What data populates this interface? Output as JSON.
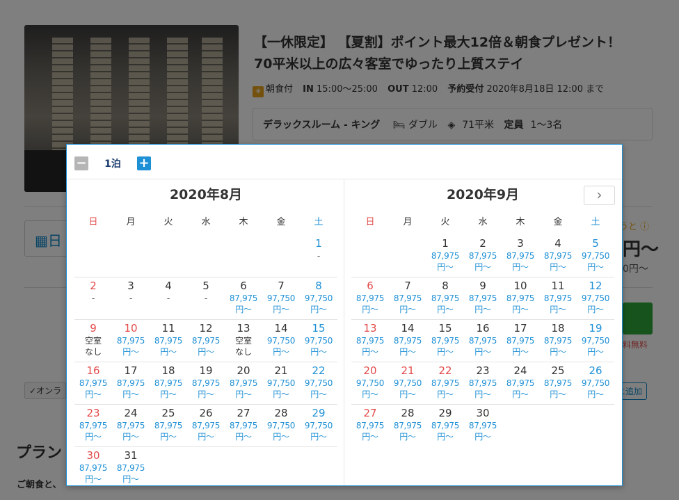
{
  "plan": {
    "title_line1": "【一休限定】 【夏割】ポイント最大12倍＆朝食プレゼント！",
    "title_line2": "70平米以上の広々客室でゆったり上質ステイ",
    "meal": "朝食付",
    "in_label": "IN",
    "in_time": "15:00〜25:00",
    "out_label": "OUT",
    "out_time": "12:00",
    "booking_label": "予約受付",
    "booking_time": "2020年8月18日 12:00 まで"
  },
  "room": {
    "name": "デラックスルーム - キング",
    "bed": "ダブル",
    "size": "71平米",
    "capacity_label": "定員",
    "capacity": "1〜3名"
  },
  "background": {
    "date_field": "日",
    "price_hint": "うと",
    "price_main": "円〜",
    "price_sub": "0円〜",
    "cancel_note": "料無料",
    "online_tag": "オンラ",
    "add_button": "に追加",
    "section_title": "プラン",
    "description": "ご朝食と、"
  },
  "calendar": {
    "nights_label": "1泊",
    "minus_symbol": "−",
    "plus_symbol": "+",
    "next_symbol": "›",
    "weekdays": [
      "日",
      "月",
      "火",
      "水",
      "木",
      "金",
      "土"
    ],
    "months": [
      {
        "title": "2020年8月",
        "weeks": [
          [
            {
              "d": ""
            },
            {
              "d": ""
            },
            {
              "d": ""
            },
            {
              "d": ""
            },
            {
              "d": ""
            },
            {
              "d": ""
            },
            {
              "d": "1",
              "a": [
                "-"
              ]
            }
          ],
          [
            {
              "d": "2",
              "a": [
                "-"
              ]
            },
            {
              "d": "3",
              "a": [
                "-"
              ]
            },
            {
              "d": "4",
              "a": [
                "-"
              ]
            },
            {
              "d": "5",
              "a": [
                "-"
              ]
            },
            {
              "d": "6",
              "p": [
                "87,975",
                "円〜"
              ]
            },
            {
              "d": "7",
              "p": [
                "97,750",
                "円〜"
              ]
            },
            {
              "d": "8",
              "p": [
                "97,750",
                "円〜"
              ]
            }
          ],
          [
            {
              "d": "9",
              "a": [
                "空室",
                "なし"
              ]
            },
            {
              "d": "10",
              "h": true,
              "p": [
                "87,975",
                "円〜"
              ]
            },
            {
              "d": "11",
              "p": [
                "87,975",
                "円〜"
              ]
            },
            {
              "d": "12",
              "p": [
                "87,975",
                "円〜"
              ]
            },
            {
              "d": "13",
              "a": [
                "空室",
                "なし"
              ]
            },
            {
              "d": "14",
              "p": [
                "97,750",
                "円〜"
              ]
            },
            {
              "d": "15",
              "p": [
                "97,750",
                "円〜"
              ]
            }
          ],
          [
            {
              "d": "16",
              "p": [
                "87,975",
                "円〜"
              ]
            },
            {
              "d": "17",
              "p": [
                "87,975",
                "円〜"
              ]
            },
            {
              "d": "18",
              "p": [
                "87,975",
                "円〜"
              ]
            },
            {
              "d": "19",
              "p": [
                "87,975",
                "円〜"
              ]
            },
            {
              "d": "20",
              "p": [
                "87,975",
                "円〜"
              ]
            },
            {
              "d": "21",
              "p": [
                "97,750",
                "円〜"
              ]
            },
            {
              "d": "22",
              "p": [
                "97,750",
                "円〜"
              ]
            }
          ],
          [
            {
              "d": "23",
              "p": [
                "87,975",
                "円〜"
              ]
            },
            {
              "d": "24",
              "p": [
                "87,975",
                "円〜"
              ]
            },
            {
              "d": "25",
              "p": [
                "87,975",
                "円〜"
              ]
            },
            {
              "d": "26",
              "p": [
                "87,975",
                "円〜"
              ]
            },
            {
              "d": "27",
              "p": [
                "87,975",
                "円〜"
              ]
            },
            {
              "d": "28",
              "p": [
                "97,750",
                "円〜"
              ]
            },
            {
              "d": "29",
              "p": [
                "97,750",
                "円〜"
              ]
            }
          ],
          [
            {
              "d": "30",
              "p": [
                "87,975",
                "円〜"
              ]
            },
            {
              "d": "31",
              "p": [
                "87,975",
                "円〜"
              ]
            },
            {
              "d": ""
            },
            {
              "d": ""
            },
            {
              "d": ""
            },
            {
              "d": ""
            },
            {
              "d": ""
            }
          ]
        ]
      },
      {
        "title": "2020年9月",
        "weeks": [
          [
            {
              "d": ""
            },
            {
              "d": ""
            },
            {
              "d": "1",
              "p": [
                "87,975",
                "円〜"
              ]
            },
            {
              "d": "2",
              "p": [
                "87,975",
                "円〜"
              ]
            },
            {
              "d": "3",
              "p": [
                "87,975",
                "円〜"
              ]
            },
            {
              "d": "4",
              "p": [
                "87,975",
                "円〜"
              ]
            },
            {
              "d": "5",
              "p": [
                "97,750",
                "円〜"
              ]
            }
          ],
          [
            {
              "d": "6",
              "p": [
                "87,975",
                "円〜"
              ]
            },
            {
              "d": "7",
              "p": [
                "87,975",
                "円〜"
              ]
            },
            {
              "d": "8",
              "p": [
                "87,975",
                "円〜"
              ]
            },
            {
              "d": "9",
              "p": [
                "87,975",
                "円〜"
              ]
            },
            {
              "d": "10",
              "p": [
                "87,975",
                "円〜"
              ]
            },
            {
              "d": "11",
              "p": [
                "87,975",
                "円〜"
              ]
            },
            {
              "d": "12",
              "p": [
                "97,750",
                "円〜"
              ]
            }
          ],
          [
            {
              "d": "13",
              "p": [
                "87,975",
                "円〜"
              ]
            },
            {
              "d": "14",
              "p": [
                "87,975",
                "円〜"
              ]
            },
            {
              "d": "15",
              "p": [
                "87,975",
                "円〜"
              ]
            },
            {
              "d": "16",
              "p": [
                "87,975",
                "円〜"
              ]
            },
            {
              "d": "17",
              "p": [
                "87,975",
                "円〜"
              ]
            },
            {
              "d": "18",
              "p": [
                "87,975",
                "円〜"
              ]
            },
            {
              "d": "19",
              "p": [
                "97,750",
                "円〜"
              ]
            }
          ],
          [
            {
              "d": "20",
              "p": [
                "97,750",
                "円〜"
              ]
            },
            {
              "d": "21",
              "h": true,
              "p": [
                "97,750",
                "円〜"
              ]
            },
            {
              "d": "22",
              "h": true,
              "p": [
                "87,975",
                "円〜"
              ]
            },
            {
              "d": "23",
              "p": [
                "87,975",
                "円〜"
              ]
            },
            {
              "d": "24",
              "p": [
                "87,975",
                "円〜"
              ]
            },
            {
              "d": "25",
              "p": [
                "87,975",
                "円〜"
              ]
            },
            {
              "d": "26",
              "p": [
                "97,750",
                "円〜"
              ]
            }
          ],
          [
            {
              "d": "27",
              "p": [
                "87,975",
                "円〜"
              ]
            },
            {
              "d": "28",
              "p": [
                "87,975",
                "円〜"
              ]
            },
            {
              "d": "29",
              "p": [
                "87,975",
                "円〜"
              ]
            },
            {
              "d": "30",
              "p": [
                "87,975",
                "円〜"
              ]
            },
            {
              "d": ""
            },
            {
              "d": ""
            },
            {
              "d": ""
            }
          ]
        ]
      }
    ]
  }
}
